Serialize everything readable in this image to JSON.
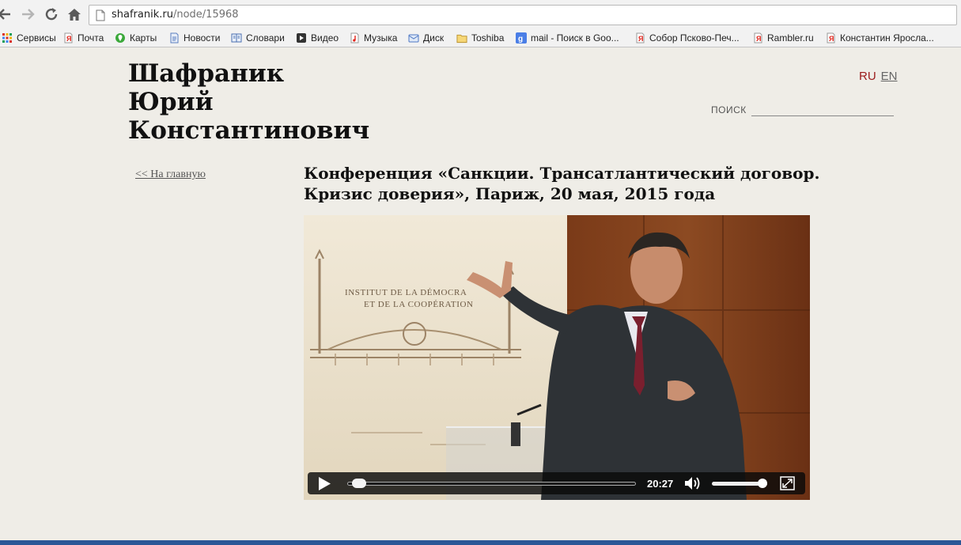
{
  "browser": {
    "url_host": "shafranik.ru",
    "url_path": "/node/15968",
    "bookmarks": [
      {
        "label": "Сервисы",
        "icon": "apps-grid-icon"
      },
      {
        "label": "Почта",
        "icon": "yandex-mail-icon"
      },
      {
        "label": "Карты",
        "icon": "maps-icon"
      },
      {
        "label": "Новости",
        "icon": "page-icon"
      },
      {
        "label": "Словари",
        "icon": "dictionary-icon"
      },
      {
        "label": "Видео",
        "icon": "video-icon"
      },
      {
        "label": "Музыка",
        "icon": "music-icon"
      },
      {
        "label": "Диск",
        "icon": "disk-icon"
      },
      {
        "label": "Toshiba",
        "icon": "folder-icon"
      },
      {
        "label": "mail - Поиск в Goo...",
        "icon": "google-icon"
      },
      {
        "label": "Собор Псково-Печ...",
        "icon": "yandex-icon"
      },
      {
        "label": "Rambler.ru",
        "icon": "yandex-icon"
      },
      {
        "label": "Константин Яросла...",
        "icon": "yandex-icon"
      }
    ]
  },
  "site": {
    "title_lines": [
      "Шафраник",
      "Юрий",
      "Константинович"
    ],
    "lang_ru": "RU",
    "lang_en": "EN",
    "search_label": "ПОИСК",
    "search_value": ""
  },
  "article": {
    "back_link": "<< На главную",
    "title": "Конференция «Санкции. Трансатлантический договор. Кризис доверия», Париж, 20 мая, 2015 года",
    "banner_text_1": "INSTITUT DE LA DÉMOCRA",
    "banner_text_2": "ET DE LA COOPÉRATION"
  },
  "video": {
    "time": "20:27",
    "progress": 0.02,
    "volume": 1.0
  },
  "colors": {
    "page_bg": "#efede7",
    "lang_active": "#9b1b1b",
    "taskbar": "#2b5797"
  }
}
